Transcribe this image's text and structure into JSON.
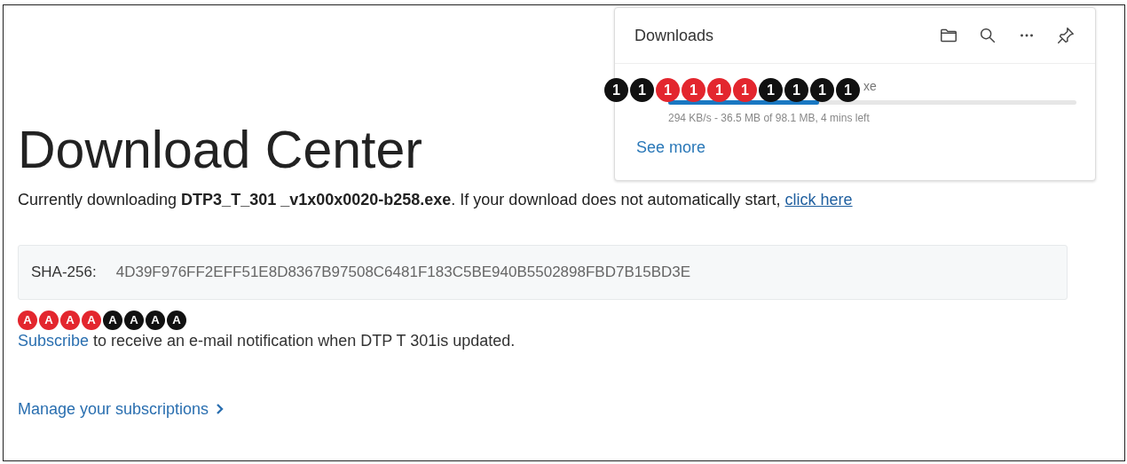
{
  "downloads_panel": {
    "title": "Downloads",
    "file": {
      "name_visible": "xe",
      "level": 0.37,
      "status": "294 KB/s - 36.5 MB of 98.1 MB, 4 mins left"
    },
    "see_more": "See more"
  },
  "callouts_1": [
    {
      "label": "1",
      "color": "#111111"
    },
    {
      "label": "1",
      "color": "#111111"
    },
    {
      "label": "1",
      "color": "#e3262e"
    },
    {
      "label": "1",
      "color": "#e3262e"
    },
    {
      "label": "1",
      "color": "#e3262e"
    },
    {
      "label": "1",
      "color": "#e3262e"
    },
    {
      "label": "1",
      "color": "#111111"
    },
    {
      "label": "1",
      "color": "#111111"
    },
    {
      "label": "1",
      "color": "#111111"
    },
    {
      "label": "1",
      "color": "#111111"
    }
  ],
  "heading": "Download Center",
  "download_notice": {
    "text": "Currently downloading **DTP3_T_301 _v1x00x0020-b258.exe**. If your download does not automatically start, ",
    "link": "click here"
  },
  "hash": {
    "label": "SHA-256:",
    "value": "4D39F976FF2EFF51E8D8367B97508C6481F183C5BE940B5502898FBD7B15BD3E"
  },
  "callouts_a": [
    {
      "label": "A",
      "color": "#e3262e"
    },
    {
      "label": "A",
      "color": "#e3262e"
    },
    {
      "label": "A",
      "color": "#e3262e"
    },
    {
      "label": "A",
      "color": "#e3262e"
    },
    {
      "label": "A",
      "color": "#111111"
    },
    {
      "label": "A",
      "color": "#111111"
    },
    {
      "label": "A",
      "color": "#111111"
    },
    {
      "label": "A",
      "color": "#111111"
    }
  ],
  "subscribe": {
    "link": "Subscribe",
    "text": " to receive an e-mail notification when DTP T 301is updated."
  },
  "manage": "Manage your subscriptions"
}
